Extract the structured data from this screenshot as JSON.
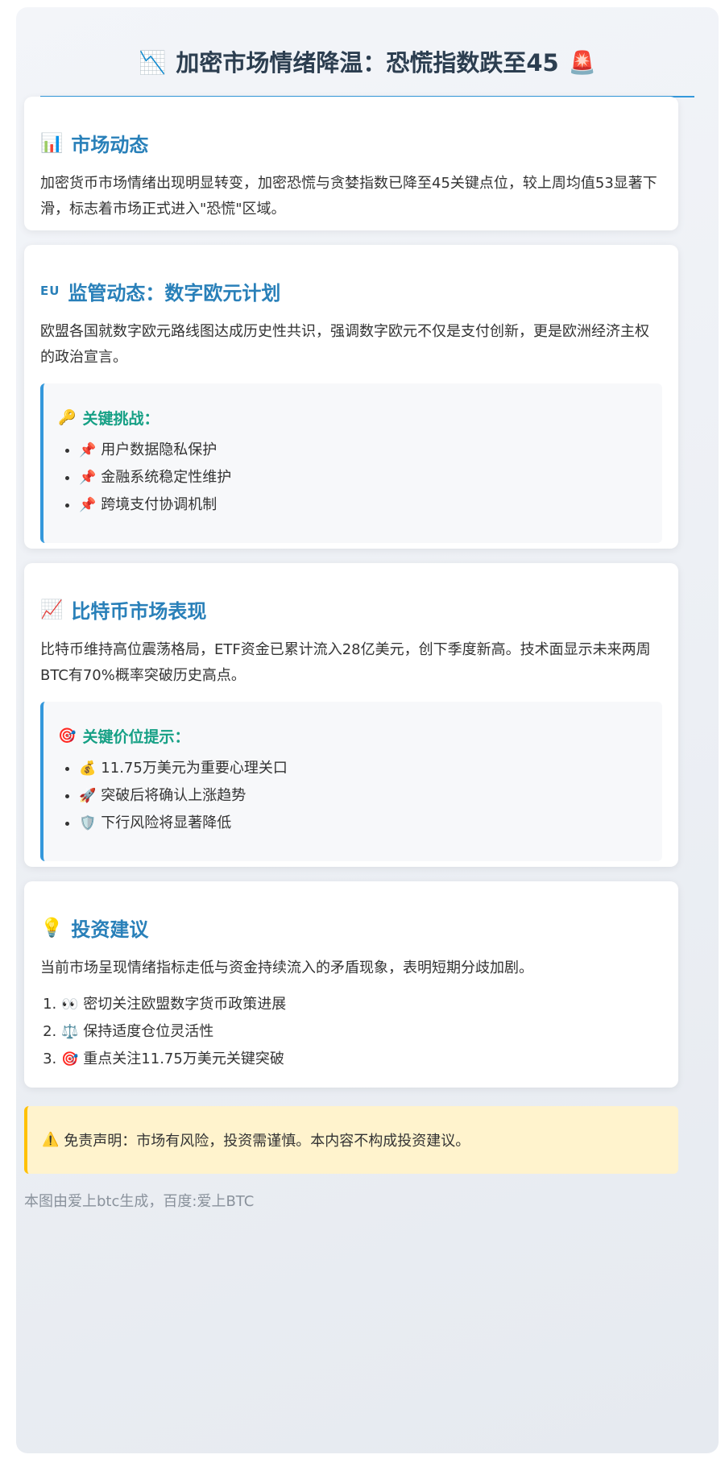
{
  "page": {
    "title": "加密市场情绪降温：恐慌指数跌至45",
    "title_icon_left": "📉",
    "title_icon_right": "🚨"
  },
  "market": {
    "icon": "📊",
    "title": "市场动态",
    "text": "加密货币市场情绪出现明显转变，加密恐慌与贪婪指数已降至45关键点位，较上周均值53显著下滑，标志着市场正式进入\"恐慌\"区域。"
  },
  "regulation": {
    "icon": "EU",
    "title": "监管动态：数字欧元计划",
    "text": "欧盟各国就数字欧元路线图达成历史性共识，强调数字欧元不仅是支付创新，更是欧洲经济主权的政治宣言。",
    "challenges": {
      "icon": "🔑",
      "title": "关键挑战：",
      "items": [
        {
          "icon": "📌",
          "label": "用户数据隐私保护"
        },
        {
          "icon": "📌",
          "label": "金融系统稳定性维护"
        },
        {
          "icon": "📌",
          "label": "跨境支付协调机制"
        }
      ]
    }
  },
  "bitcoin": {
    "icon": "📈",
    "title": "比特币市场表现",
    "text": "比特币维持高位震荡格局，ETF资金已累计流入28亿美元，创下季度新高。技术面显示未来两周BTC有70%概率突破历史高点。",
    "levels": {
      "icon": "🎯",
      "title": "关键价位提示：",
      "items": [
        {
          "icon": "💰",
          "label": "11.75万美元为重要心理关口"
        },
        {
          "icon": "🚀",
          "label": "突破后将确认上涨趋势"
        },
        {
          "icon": "🛡️",
          "label": "下行风险将显著降低"
        }
      ]
    }
  },
  "advice": {
    "icon": "💡",
    "title": "投资建议",
    "text": "当前市场呈现情绪指标走低与资金持续流入的矛盾现象，表明短期分歧加剧。",
    "steps": [
      {
        "icon": "👀",
        "label": "密切关注欧盟数字货币政策进展"
      },
      {
        "icon": "⚖️",
        "label": "保持适度仓位灵活性"
      },
      {
        "icon": "🎯",
        "label": "重点关注11.75万美元关键突破"
      }
    ]
  },
  "disclaimer": {
    "icon": "⚠️",
    "text": "免责声明：市场有风险，投资需谨慎。本内容不构成投资建议。"
  },
  "footer": {
    "text": "本图由爱上btc生成，百度:爱上BTC"
  },
  "colors": {
    "title": "#2c3e50",
    "accent_blue": "#3498db",
    "section_title": "#2980b9",
    "highlight_title": "#16a085",
    "warning_bg": "#fff3cd",
    "warning_border": "#ffc107"
  }
}
